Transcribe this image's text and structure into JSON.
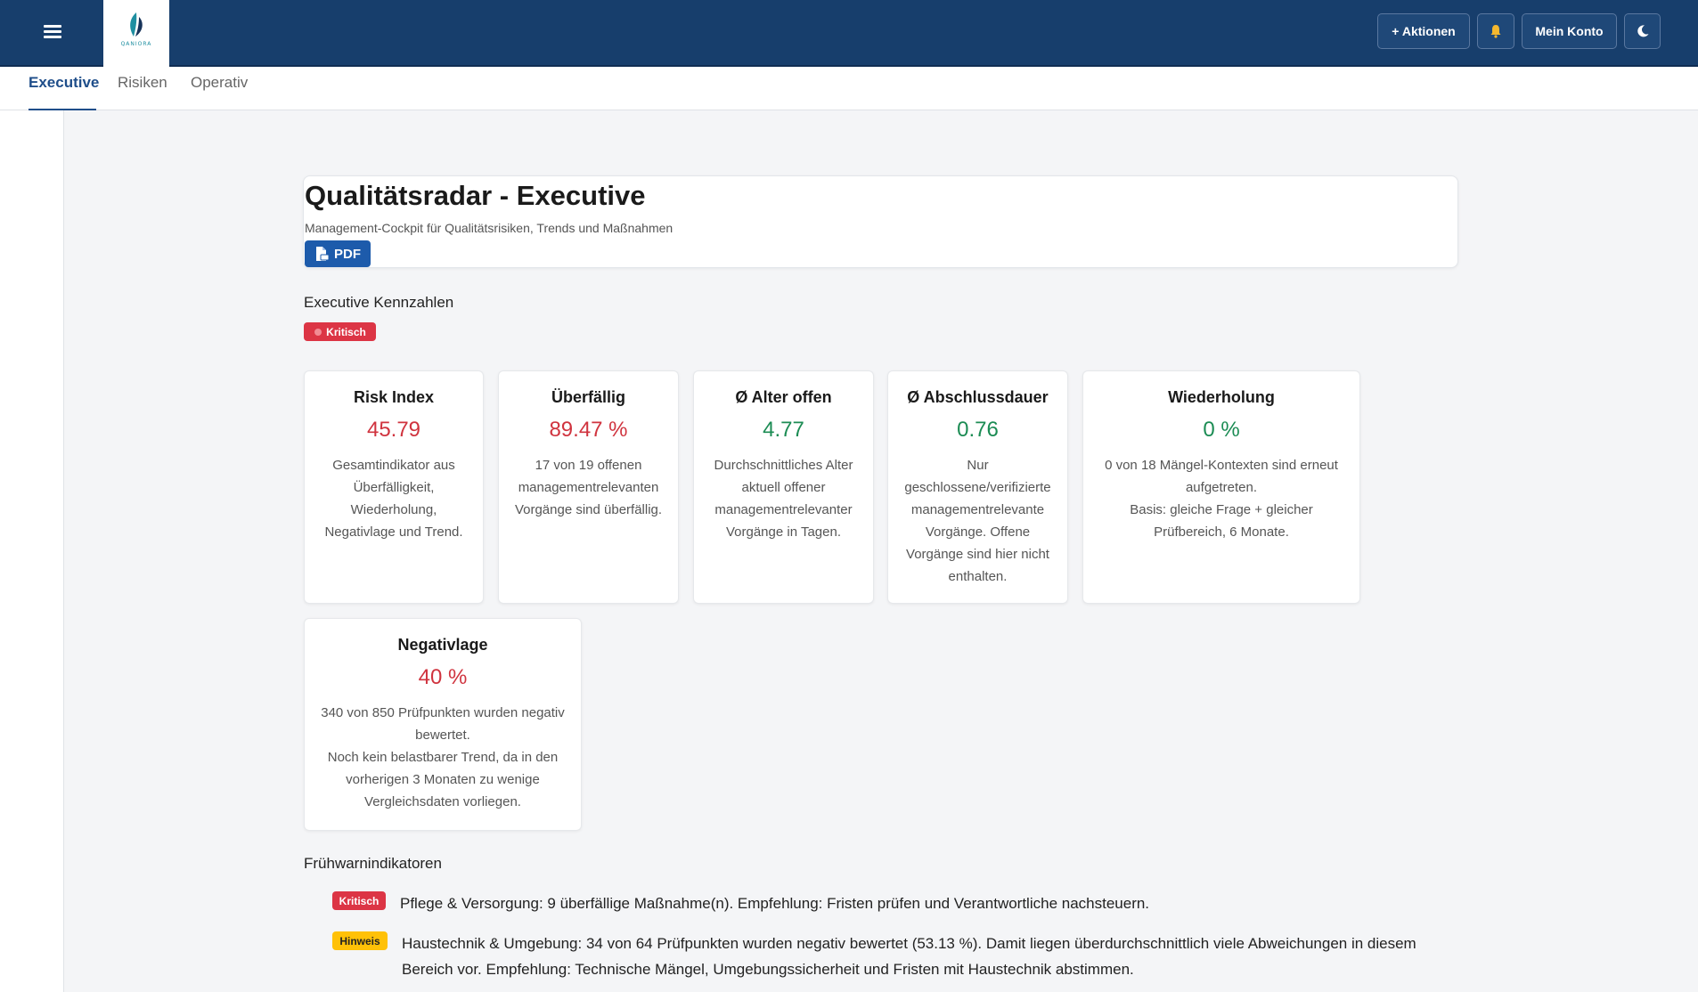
{
  "topbar": {
    "logo_text": "QANIORA",
    "actions_label": "+ Aktionen",
    "account_label": "Mein Konto",
    "bell_icon": "bell-icon",
    "moon_icon": "moon-icon",
    "menu_icon": "hamburger-icon",
    "colors": {
      "background": "#173e6c",
      "bell": "#f5b82e"
    }
  },
  "tabs": [
    {
      "label": "Executive",
      "active": true
    },
    {
      "label": "Risiken",
      "active": false
    },
    {
      "label": "Operativ",
      "active": false
    }
  ],
  "header": {
    "title": "Qualitätsradar - Executive",
    "subtitle": "Management-Cockpit für Qualitätsrisiken, Trends und Maßnahmen",
    "pdf_label": "PDF"
  },
  "kpi_section": {
    "title": "Executive Kennzahlen",
    "badge": "Kritisch"
  },
  "kpis": [
    {
      "title": "Risk Index",
      "value": "45.79",
      "status": "red",
      "desc": [
        "Gesamtindikator aus Überfälligkeit, Wiederholung, Negativlage und Trend."
      ]
    },
    {
      "title": "Überfällig",
      "value": "89.47 %",
      "status": "red",
      "desc": [
        "17 von 19 offenen managementrelevanten Vorgänge sind überfällig."
      ]
    },
    {
      "title": "Ø Alter offen",
      "value": "4.77",
      "status": "green",
      "desc": [
        "Durchschnittliches Alter aktuell offener managementrelevanter Vorgänge in Tagen."
      ]
    },
    {
      "title": "Ø Abschlussdauer",
      "value": "0.76",
      "status": "green",
      "desc": [
        "Nur geschlossene/verifizierte managementrelevante Vorgänge. Offene Vorgänge sind hier nicht enthalten."
      ]
    },
    {
      "title": "Wiederholung",
      "value": "0 %",
      "status": "green",
      "desc": [
        "0 von 18 Mängel-Kontexten sind erneut aufgetreten.",
        "Basis: gleiche Frage + gleicher Prüfbereich, 6 Monate."
      ]
    },
    {
      "title": "Negativlage",
      "value": "40 %",
      "status": "red",
      "desc": [
        "340 von 850 Prüfpunkten wurden negativ bewertet.",
        "Noch kein belastbarer Trend, da in den vorherigen 3 Monaten zu wenige Vergleichsdaten vorliegen."
      ]
    }
  ],
  "warnings": {
    "title": "Frühwarnindikatoren",
    "items": [
      {
        "badge": "Kritisch",
        "level": "critical",
        "text": "Pflege & Versorgung: 9 überfällige Maßnahme(n). Empfehlung: Fristen prüfen und Verantwortliche nachsteuern."
      },
      {
        "badge": "Hinweis",
        "level": "hint",
        "text": "Haustechnik & Umgebung: 34 von 64 Prüfpunkten wurden negativ bewertet (53.13 %). Damit liegen überdurchschnittlich viele Abweichungen in diesem Bereich vor. Empfehlung: Technische Mängel, Umgebungssicherheit und Fristen mit Haustechnik abstimmen."
      }
    ]
  }
}
